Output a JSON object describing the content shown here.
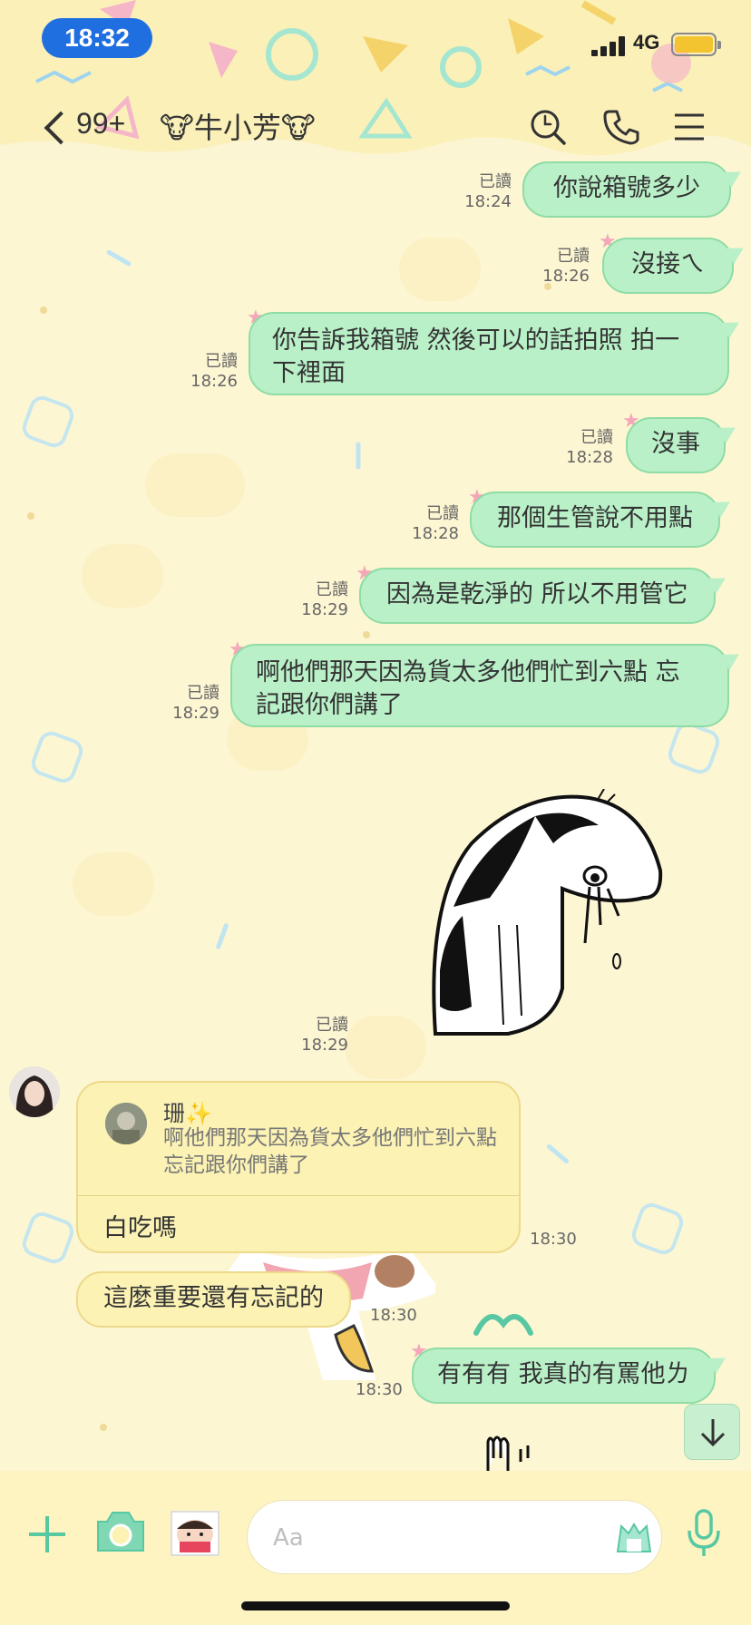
{
  "status_bar": {
    "time": "18:32",
    "network": "4G"
  },
  "header": {
    "unread_count": "99+",
    "chat_title": "🐮牛小芳🐮",
    "icons": [
      "back-chevron-icon",
      "search-icon",
      "phone-icon",
      "menu-icon"
    ]
  },
  "colors": {
    "my_bubble": "#b9f0c8",
    "their_bubble": "#fbf2b4",
    "time_pill": "#1f6fe0",
    "battery": "#f4c430"
  },
  "messages": [
    {
      "text": "你說箱號多少",
      "read": "已讀",
      "time": "18:24"
    },
    {
      "text": "沒接ㄟ",
      "read": "已讀",
      "time": "18:26"
    },
    {
      "line1": "你告訴我箱號 然後可以的話拍照 拍一",
      "line2": "下裡面",
      "read": "已讀",
      "time": "18:26"
    },
    {
      "text": "沒事",
      "read": "已讀",
      "time": "18:28"
    },
    {
      "text": "那個生管說不用點",
      "read": "已讀",
      "time": "18:28"
    },
    {
      "text": "因為是乾淨的 所以不用管它",
      "read": "已讀",
      "time": "18:29"
    },
    {
      "line1": "啊他們那天因為貨太多他們忙到六點 忘",
      "line2": "記跟你們講了",
      "read": "已讀",
      "time": "18:29"
    },
    {
      "sticker": "crying-character-sticker",
      "read": "已讀",
      "time": "18:29"
    }
  ],
  "reply": {
    "sender_name": "珊✨",
    "quoted_text": "啊他們那天因為貨太多他們忙到六點 忘記跟你們講了",
    "text": "白吃嗎",
    "time": "18:30"
  },
  "incoming2": {
    "text": "這麼重要還有忘記的",
    "time": "18:30"
  },
  "outgoing_last": {
    "text": "有有有 我真的有罵他ㄌ",
    "time": "18:30"
  },
  "input": {
    "placeholder": "Aa"
  }
}
